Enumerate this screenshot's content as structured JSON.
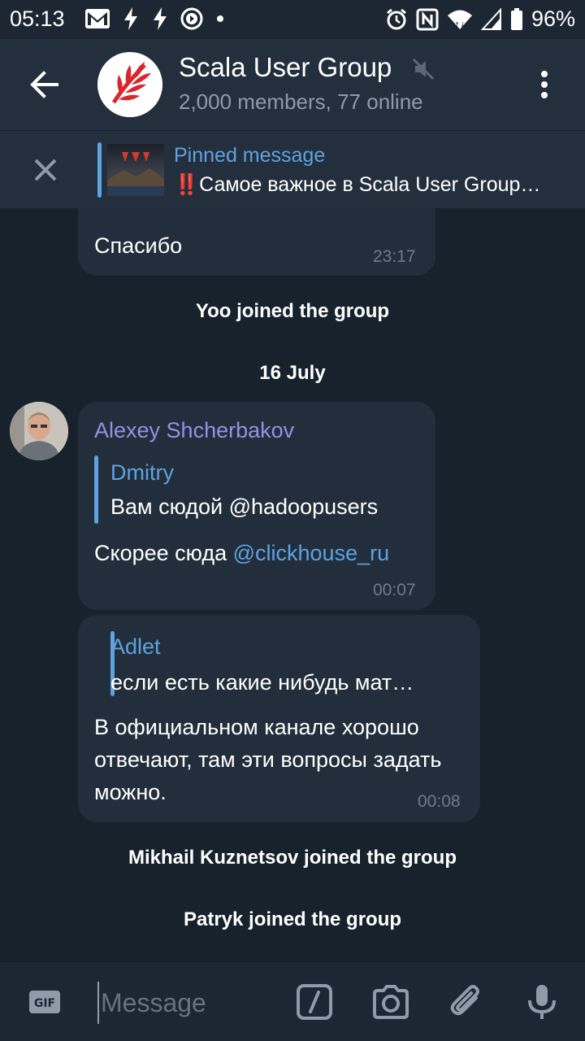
{
  "status_bar": {
    "time": "05:13",
    "battery": "96%",
    "left_icons": [
      "gmail-icon",
      "flash-icon",
      "flash-icon",
      "play-icon",
      "dot-icon"
    ],
    "right_icons": [
      "alarm-icon",
      "nfc-icon",
      "wifi-icon",
      "signal-icon",
      "battery-icon"
    ]
  },
  "header": {
    "title": "Scala User Group",
    "subtitle": "2,000 members, 77 online"
  },
  "pinned": {
    "label": "Pinned message",
    "text": "‼️Самое важное в Scala User Group…"
  },
  "messages": {
    "partial": {
      "text": "Спасибо",
      "time": "23:17"
    },
    "service_1": "Yoo joined the group",
    "date_divider": "16 July",
    "msg_1": {
      "sender": "Alexey Shcherbakov",
      "reply_name": "Dmitry",
      "reply_text": "Вам сюдой @hadoopusers",
      "text_prefix": "Скорее сюда ",
      "text_link": "@clickhouse_ru",
      "time": "00:07"
    },
    "msg_2": {
      "reply_name": "Adlet",
      "reply_text": "если есть какие нибудь мат…",
      "text": "В официальном канале хорошо отвечают, там эти вопросы задать можно.",
      "time": "00:08"
    },
    "service_2": "Mikhail Kuznetsov joined the group",
    "service_3": "Patryk joined the group"
  },
  "input": {
    "placeholder": "Message"
  },
  "colors": {
    "background": "#18222d",
    "header": "#242f3d",
    "bubble": "#222e3b",
    "accent": "#5ea2e0",
    "sender": "#9a8de6"
  }
}
